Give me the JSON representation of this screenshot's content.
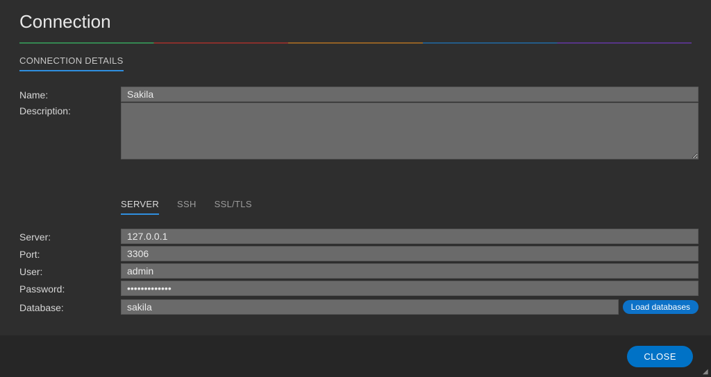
{
  "dialog": {
    "title": "Connection",
    "section_header": "CONNECTION DETAILS",
    "close_label": "CLOSE"
  },
  "labels": {
    "name": "Name:",
    "description": "Description:",
    "server": "Server:",
    "port": "Port:",
    "user": "User:",
    "password": "Password:",
    "database": "Database:"
  },
  "values": {
    "name": "Sakila",
    "description": "",
    "server": "127.0.0.1",
    "port": "3306",
    "user": "admin",
    "password": "•••••••••••••",
    "database": "sakila"
  },
  "tabs": {
    "server": "SERVER",
    "ssh": "SSH",
    "ssltls": "SSL/TLS"
  },
  "buttons": {
    "load_databases": "Load databases"
  },
  "colors": {
    "accent": "#0072c6",
    "tab_underline": "#2f8fe0",
    "input_bg": "#6a6a6a",
    "panel_bg": "#2e2e2e",
    "footer_bg": "#262626"
  }
}
